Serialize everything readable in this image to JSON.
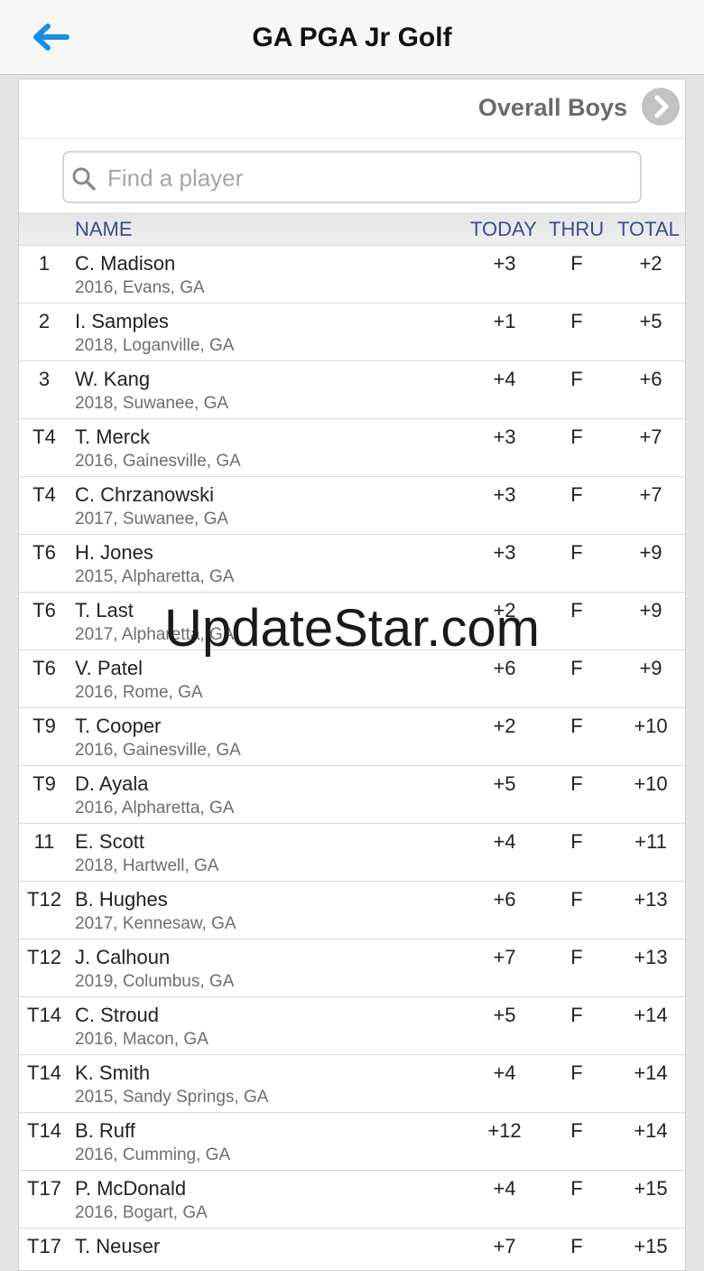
{
  "header": {
    "title": "GA PGA Jr Golf",
    "back_icon": "arrow-left-icon",
    "accent_color": "#1a8ee6"
  },
  "category": {
    "title": "Overall Boys",
    "next_icon": "chevron-right-circle-icon"
  },
  "search": {
    "placeholder": "Find a player",
    "value": "",
    "icon": "search-icon"
  },
  "columns": {
    "name": "NAME",
    "today": "TODAY",
    "thru": "THRU",
    "total": "TOTAL"
  },
  "players": [
    {
      "pos": "1",
      "name": "C. Madison",
      "detail": "2016, Evans, GA",
      "today": "+3",
      "thru": "F",
      "total": "+2"
    },
    {
      "pos": "2",
      "name": "I. Samples",
      "detail": "2018, Loganville, GA",
      "today": "+1",
      "thru": "F",
      "total": "+5"
    },
    {
      "pos": "3",
      "name": "W. Kang",
      "detail": "2018, Suwanee, GA",
      "today": "+4",
      "thru": "F",
      "total": "+6"
    },
    {
      "pos": "T4",
      "name": "T. Merck",
      "detail": "2016, Gainesville, GA",
      "today": "+3",
      "thru": "F",
      "total": "+7"
    },
    {
      "pos": "T4",
      "name": "C. Chrzanowski",
      "detail": "2017, Suwanee, GA",
      "today": "+3",
      "thru": "F",
      "total": "+7"
    },
    {
      "pos": "T6",
      "name": "H. Jones",
      "detail": "2015, Alpharetta, GA",
      "today": "+3",
      "thru": "F",
      "total": "+9"
    },
    {
      "pos": "T6",
      "name": "T. Last",
      "detail": "2017, Alpharetta, GA",
      "today": "+2",
      "thru": "F",
      "total": "+9"
    },
    {
      "pos": "T6",
      "name": "V. Patel",
      "detail": "2016, Rome, GA",
      "today": "+6",
      "thru": "F",
      "total": "+9"
    },
    {
      "pos": "T9",
      "name": "T. Cooper",
      "detail": "2016, Gainesville, GA",
      "today": "+2",
      "thru": "F",
      "total": "+10"
    },
    {
      "pos": "T9",
      "name": "D. Ayala",
      "detail": "2016, Alpharetta, GA",
      "today": "+5",
      "thru": "F",
      "total": "+10"
    },
    {
      "pos": "11",
      "name": "E. Scott",
      "detail": "2018, Hartwell, GA",
      "today": "+4",
      "thru": "F",
      "total": "+11"
    },
    {
      "pos": "T12",
      "name": "B. Hughes",
      "detail": "2017, Kennesaw, GA",
      "today": "+6",
      "thru": "F",
      "total": "+13"
    },
    {
      "pos": "T12",
      "name": "J. Calhoun",
      "detail": "2019, Columbus, GA",
      "today": "+7",
      "thru": "F",
      "total": "+13"
    },
    {
      "pos": "T14",
      "name": "C. Stroud",
      "detail": "2016, Macon, GA",
      "today": "+5",
      "thru": "F",
      "total": "+14"
    },
    {
      "pos": "T14",
      "name": "K. Smith",
      "detail": "2015, Sandy Springs, GA",
      "today": "+4",
      "thru": "F",
      "total": "+14"
    },
    {
      "pos": "T14",
      "name": "B. Ruff",
      "detail": "2016, Cumming, GA",
      "today": "+12",
      "thru": "F",
      "total": "+14"
    },
    {
      "pos": "T17",
      "name": "P. McDonald",
      "detail": "2016, Bogart, GA",
      "today": "+4",
      "thru": "F",
      "total": "+15"
    },
    {
      "pos": "T17",
      "name": "T. Neuser",
      "detail": "",
      "today": "+7",
      "thru": "F",
      "total": "+15"
    }
  ],
  "watermark": "UpdateStar.com"
}
